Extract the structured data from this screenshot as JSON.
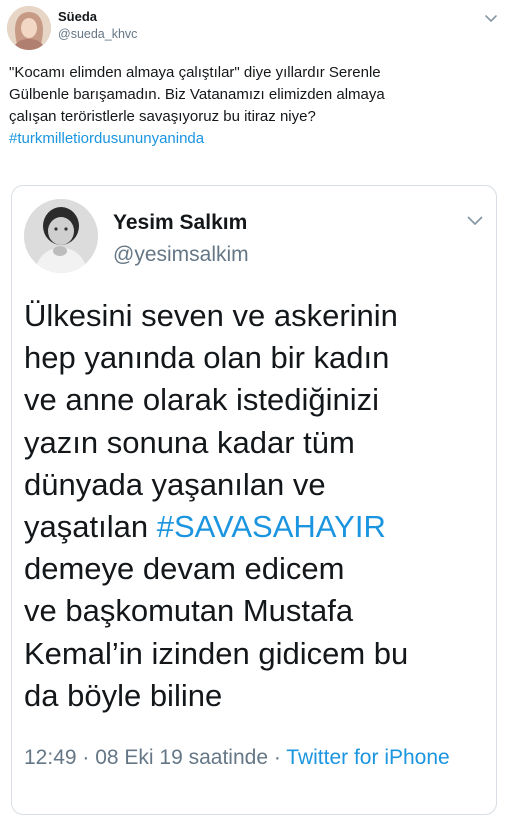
{
  "tweet": {
    "display_name": "Süeda",
    "handle": "@sueda_khvc",
    "text_lines": [
      "\"Kocamı elimden almaya çalıştılar\" diye yıllardır Serenle",
      "Gülbenle barışamadın. Biz Vatanamızı elimizden almaya",
      "çalışan teröristlerle savaşıyoruz  bu itiraz  niye?"
    ],
    "hashtag": "#turkmilletiordusununyaninda",
    "menu_icon": "chevron-down-icon"
  },
  "quoted_tweet": {
    "display_name": "Yesim Salkım",
    "handle": "@yesimsalkim",
    "text_lines": [
      "Ülkesini seven ve askerinin",
      "hep yanında olan bir kadın",
      "ve anne olarak istediğinizi",
      "yazın sonuna kadar tüm",
      "dünyada yaşanılan ve"
    ],
    "line6_prefix": "yaşatılan ",
    "hashtag": "#SAVASAHAYIR",
    "text_lines_after": [
      "demeye devam edicem",
      "ve başkomutan Mustafa",
      "Kemal’in izinden gidicem bu",
      "da böyle biline"
    ],
    "timestamp": "12:49 · 08 Eki 19 saatinde · ",
    "source": "Twitter for iPhone",
    "menu_icon": "chevron-down-icon"
  },
  "colors": {
    "text": "#14171a",
    "secondary": "#657786",
    "link": "#1b95e0",
    "border": "#d8dee3"
  }
}
